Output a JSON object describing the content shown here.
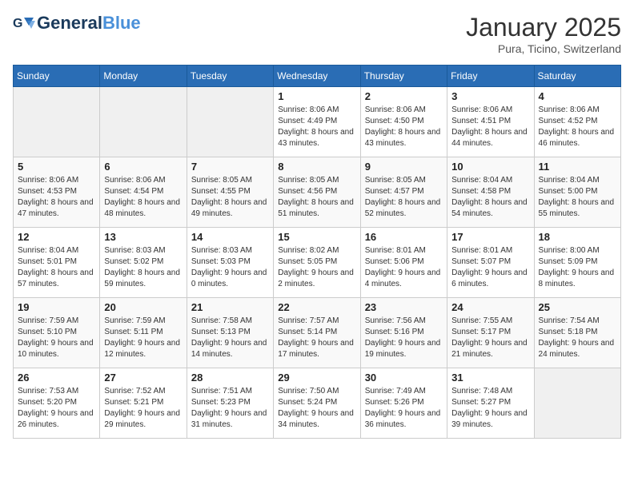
{
  "header": {
    "logo_general": "General",
    "logo_blue": "Blue",
    "month_title": "January 2025",
    "location": "Pura, Ticino, Switzerland"
  },
  "weekdays": [
    "Sunday",
    "Monday",
    "Tuesday",
    "Wednesday",
    "Thursday",
    "Friday",
    "Saturday"
  ],
  "weeks": [
    [
      {
        "day": "",
        "info": ""
      },
      {
        "day": "",
        "info": ""
      },
      {
        "day": "",
        "info": ""
      },
      {
        "day": "1",
        "info": "Sunrise: 8:06 AM\nSunset: 4:49 PM\nDaylight: 8 hours and 43 minutes."
      },
      {
        "day": "2",
        "info": "Sunrise: 8:06 AM\nSunset: 4:50 PM\nDaylight: 8 hours and 43 minutes."
      },
      {
        "day": "3",
        "info": "Sunrise: 8:06 AM\nSunset: 4:51 PM\nDaylight: 8 hours and 44 minutes."
      },
      {
        "day": "4",
        "info": "Sunrise: 8:06 AM\nSunset: 4:52 PM\nDaylight: 8 hours and 46 minutes."
      }
    ],
    [
      {
        "day": "5",
        "info": "Sunrise: 8:06 AM\nSunset: 4:53 PM\nDaylight: 8 hours and 47 minutes."
      },
      {
        "day": "6",
        "info": "Sunrise: 8:06 AM\nSunset: 4:54 PM\nDaylight: 8 hours and 48 minutes."
      },
      {
        "day": "7",
        "info": "Sunrise: 8:05 AM\nSunset: 4:55 PM\nDaylight: 8 hours and 49 minutes."
      },
      {
        "day": "8",
        "info": "Sunrise: 8:05 AM\nSunset: 4:56 PM\nDaylight: 8 hours and 51 minutes."
      },
      {
        "day": "9",
        "info": "Sunrise: 8:05 AM\nSunset: 4:57 PM\nDaylight: 8 hours and 52 minutes."
      },
      {
        "day": "10",
        "info": "Sunrise: 8:04 AM\nSunset: 4:58 PM\nDaylight: 8 hours and 54 minutes."
      },
      {
        "day": "11",
        "info": "Sunrise: 8:04 AM\nSunset: 5:00 PM\nDaylight: 8 hours and 55 minutes."
      }
    ],
    [
      {
        "day": "12",
        "info": "Sunrise: 8:04 AM\nSunset: 5:01 PM\nDaylight: 8 hours and 57 minutes."
      },
      {
        "day": "13",
        "info": "Sunrise: 8:03 AM\nSunset: 5:02 PM\nDaylight: 8 hours and 59 minutes."
      },
      {
        "day": "14",
        "info": "Sunrise: 8:03 AM\nSunset: 5:03 PM\nDaylight: 9 hours and 0 minutes."
      },
      {
        "day": "15",
        "info": "Sunrise: 8:02 AM\nSunset: 5:05 PM\nDaylight: 9 hours and 2 minutes."
      },
      {
        "day": "16",
        "info": "Sunrise: 8:01 AM\nSunset: 5:06 PM\nDaylight: 9 hours and 4 minutes."
      },
      {
        "day": "17",
        "info": "Sunrise: 8:01 AM\nSunset: 5:07 PM\nDaylight: 9 hours and 6 minutes."
      },
      {
        "day": "18",
        "info": "Sunrise: 8:00 AM\nSunset: 5:09 PM\nDaylight: 9 hours and 8 minutes."
      }
    ],
    [
      {
        "day": "19",
        "info": "Sunrise: 7:59 AM\nSunset: 5:10 PM\nDaylight: 9 hours and 10 minutes."
      },
      {
        "day": "20",
        "info": "Sunrise: 7:59 AM\nSunset: 5:11 PM\nDaylight: 9 hours and 12 minutes."
      },
      {
        "day": "21",
        "info": "Sunrise: 7:58 AM\nSunset: 5:13 PM\nDaylight: 9 hours and 14 minutes."
      },
      {
        "day": "22",
        "info": "Sunrise: 7:57 AM\nSunset: 5:14 PM\nDaylight: 9 hours and 17 minutes."
      },
      {
        "day": "23",
        "info": "Sunrise: 7:56 AM\nSunset: 5:16 PM\nDaylight: 9 hours and 19 minutes."
      },
      {
        "day": "24",
        "info": "Sunrise: 7:55 AM\nSunset: 5:17 PM\nDaylight: 9 hours and 21 minutes."
      },
      {
        "day": "25",
        "info": "Sunrise: 7:54 AM\nSunset: 5:18 PM\nDaylight: 9 hours and 24 minutes."
      }
    ],
    [
      {
        "day": "26",
        "info": "Sunrise: 7:53 AM\nSunset: 5:20 PM\nDaylight: 9 hours and 26 minutes."
      },
      {
        "day": "27",
        "info": "Sunrise: 7:52 AM\nSunset: 5:21 PM\nDaylight: 9 hours and 29 minutes."
      },
      {
        "day": "28",
        "info": "Sunrise: 7:51 AM\nSunset: 5:23 PM\nDaylight: 9 hours and 31 minutes."
      },
      {
        "day": "29",
        "info": "Sunrise: 7:50 AM\nSunset: 5:24 PM\nDaylight: 9 hours and 34 minutes."
      },
      {
        "day": "30",
        "info": "Sunrise: 7:49 AM\nSunset: 5:26 PM\nDaylight: 9 hours and 36 minutes."
      },
      {
        "day": "31",
        "info": "Sunrise: 7:48 AM\nSunset: 5:27 PM\nDaylight: 9 hours and 39 minutes."
      },
      {
        "day": "",
        "info": ""
      }
    ]
  ]
}
